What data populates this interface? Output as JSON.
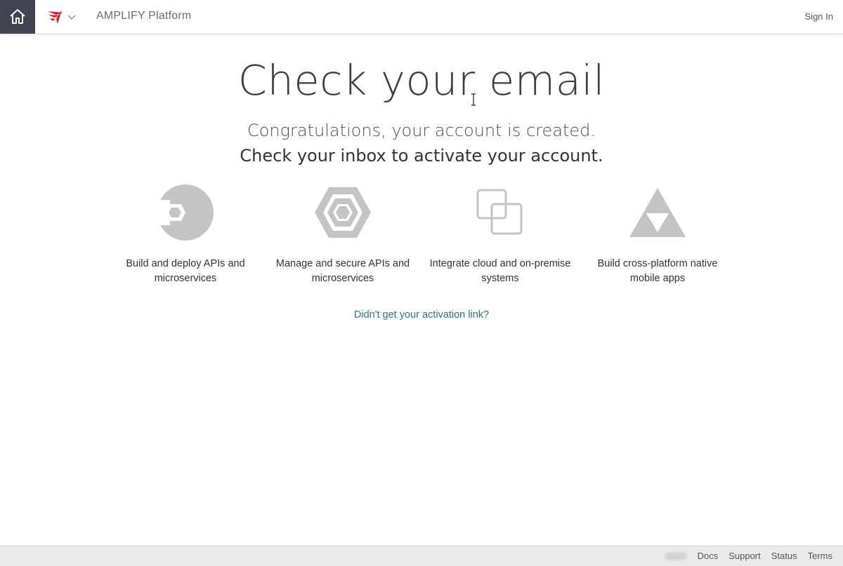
{
  "header": {
    "app_title": "AMPLIFY Platform",
    "signin_label": "Sign In",
    "home_icon": "home-icon",
    "brand_icon": "axway-logo-icon",
    "dropdown_icon": "chevron-down-icon"
  },
  "main": {
    "headline": "Check your email",
    "congrats": "Congratulations, your account is created.",
    "instruction": "Check your inbox to activate your account.",
    "features": [
      {
        "icon": "api-builder-icon",
        "label": "Build and deploy APIs and microservices"
      },
      {
        "icon": "api-management-icon",
        "label": "Manage and secure APIs and microservices"
      },
      {
        "icon": "integration-icon",
        "label": "Integrate cloud and on-premise systems"
      },
      {
        "icon": "mobile-apps-icon",
        "label": "Build cross-platform native mobile apps"
      }
    ],
    "resend_link": "Didn't get your activation link?"
  },
  "footer": {
    "links": [
      "Docs",
      "Support",
      "Status",
      "Terms"
    ]
  },
  "colors": {
    "home_bg": "#3f4450",
    "brand_red": "#d0202e",
    "icon_gray": "#c4c4c4",
    "link": "#2f6f8f",
    "footer_bg": "#ebebeb"
  }
}
